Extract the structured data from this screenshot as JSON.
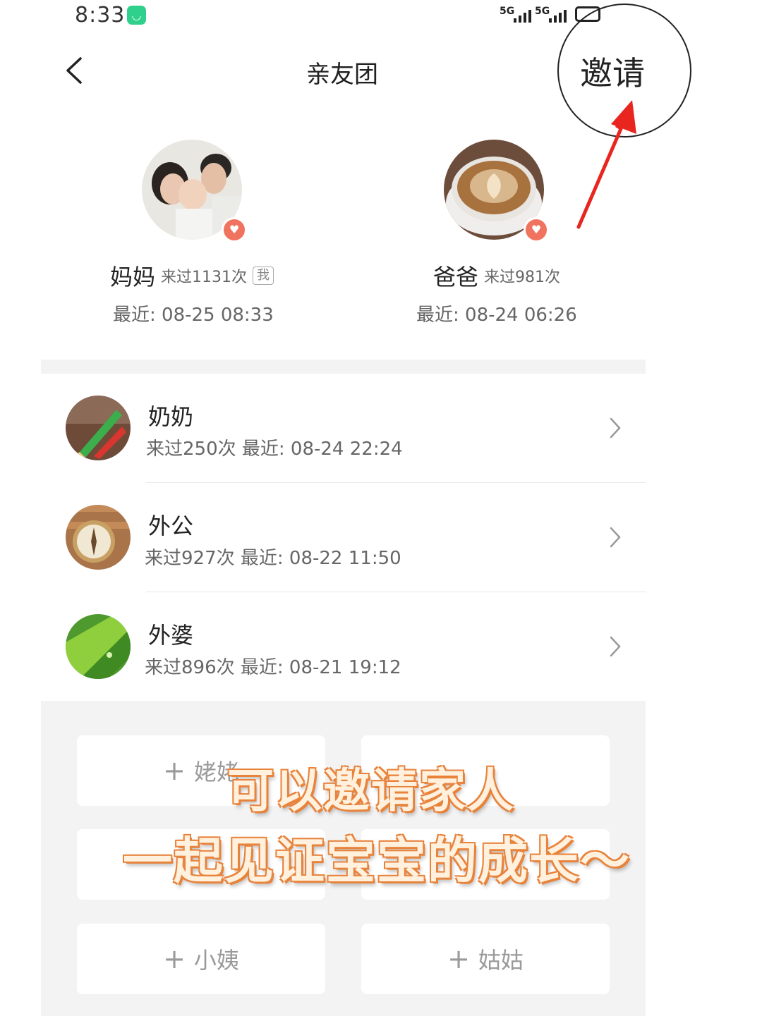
{
  "status_bar": {
    "time": "8:33",
    "signal1": "5G",
    "signal2": "5G"
  },
  "header": {
    "title": "亲友团",
    "invite_label": "邀请"
  },
  "featured": [
    {
      "name": "妈妈",
      "visits": "来过1131次",
      "tag": "我",
      "recent": "最近: 08-25 08:33"
    },
    {
      "name": "爸爸",
      "visits": "来过981次",
      "recent": "最近: 08-24 06:26"
    }
  ],
  "members": [
    {
      "name": "奶奶",
      "meta": "来过250次 最近: 08-24 22:24"
    },
    {
      "name": "外公",
      "meta": "来过927次 最近: 08-22 11:50"
    },
    {
      "name": "外婆",
      "meta": "来过896次 最近: 08-21 19:12"
    }
  ],
  "slots": [
    {
      "label": "姥姥"
    },
    {
      "label": ""
    },
    {
      "label": ""
    },
    {
      "label": ""
    },
    {
      "label": "小姨"
    },
    {
      "label": "姑姑"
    }
  ],
  "overlay": {
    "line1": "可以邀请家人",
    "line2": "一起见证宝宝的成长～"
  }
}
